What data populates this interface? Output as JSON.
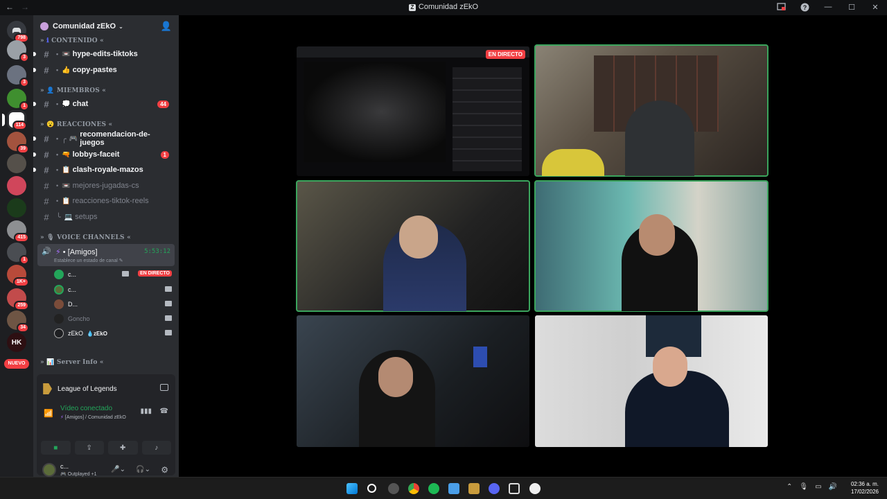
{
  "window": {
    "title": "Comunidad zEkO",
    "back": "←",
    "forward": "→",
    "controls": [
      "—",
      "☐",
      "✕"
    ]
  },
  "guilds": {
    "badges": [
      "798",
      "3",
      "3",
      "1",
      "114",
      "39",
      "415",
      "1",
      "1K+",
      "259",
      "34"
    ],
    "new_label": "NUEVO"
  },
  "sidebar": {
    "server_name": "Comunidad zEkO",
    "categories": {
      "contenido": "CONTENIDO",
      "miembros": "MIEMBROS",
      "reacciones": "REACCIONES",
      "voice": "VOICE CHANNELS",
      "server_info": "Server Info"
    },
    "channels": [
      {
        "emoji": "📼",
        "name": "hype-edits-tiktoks"
      },
      {
        "emoji": "👍",
        "name": "copy-pastes"
      },
      {
        "emoji": "💭",
        "name": "chat",
        "count": "44"
      },
      {
        "emoji": "🎮",
        "name": "recomendacion-de-juegos"
      },
      {
        "emoji": "🔫",
        "name": "lobbys-faceit",
        "count": "1"
      },
      {
        "emoji": "📋",
        "name": "clash-royale-mazos"
      },
      {
        "emoji": "📼",
        "name": "mejores-jugadas-cs"
      },
      {
        "emoji": "📋",
        "name": "reacciones-tiktok-reels"
      },
      {
        "emoji": "💻",
        "name": "setups"
      }
    ],
    "voice_channel": {
      "name": "[Amigos]",
      "timer": "5:53:12",
      "status": "Establece un estado de canal"
    },
    "voice_users": [
      {
        "name": "c...",
        "live": "EN DIRECTO"
      },
      {
        "name": "c..."
      },
      {
        "name": "D..."
      },
      {
        "name": "Goncho"
      },
      {
        "name": "zEkO",
        "tag": "zEkO"
      }
    ]
  },
  "panel": {
    "game": "League of Legends",
    "connection_status": "Vídeo conectado",
    "connection_location": "[Amigos] / Comunidad zEkO",
    "username": "c...",
    "user_status": "Outplayed +1"
  },
  "stage": {
    "live_label": "EN DIRECTO"
  },
  "taskbar": {
    "time": "02:36 a. m.",
    "date": "17/02/2026"
  }
}
